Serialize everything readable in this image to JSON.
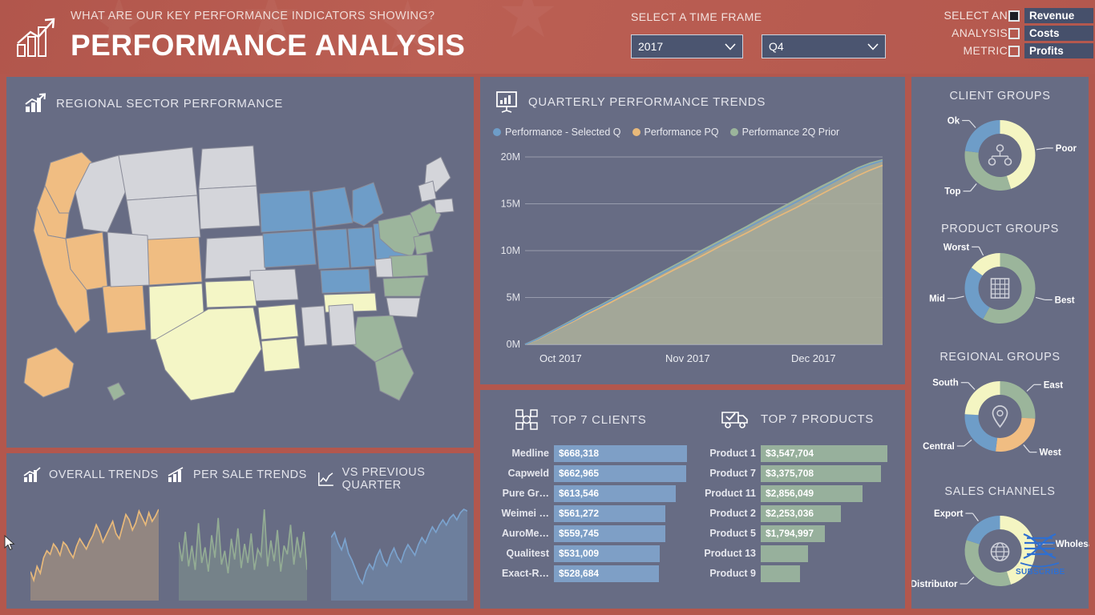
{
  "header": {
    "subtitle": "WHAT ARE OUR KEY PERFORMANCE INDICATORS SHOWING?",
    "title": "PERFORMANCE ANALYSIS",
    "logo_icon": "bar-chart-arrow-icon",
    "timeframe_label": "SELECT A TIME FRAME",
    "year_value": "2017",
    "quarter_value": "Q4",
    "metric_label_1": "SELECT AN",
    "metric_label_2": "ANALYSIS",
    "metric_label_3": "METRIC",
    "metrics": [
      {
        "label": "Revenue",
        "checked": true
      },
      {
        "label": "Costs",
        "checked": false
      },
      {
        "label": "Profits",
        "checked": false
      }
    ],
    "accent_color": "#b3574d",
    "panel_color": "#676c84"
  },
  "map_panel": {
    "title": "REGIONAL SECTOR PERFORMANCE",
    "icon": "chart-growth-icon",
    "legend_colors": {
      "high_orange": "#f0bd82",
      "mid_blue": "#6e9dc8",
      "low_yellow": "#f4f6c6",
      "green": "#9cb59c",
      "gray": "#d4d5da"
    }
  },
  "trends_panel": {
    "items": [
      {
        "label": "OVERALL TRENDS",
        "icon": "chart-growth-icon",
        "color": "#e8b97a"
      },
      {
        "label": "PER SALE TRENDS",
        "icon": "bar-chart-icon",
        "color": "#93ac94"
      },
      {
        "label": "VS PREVIOUS QUARTER",
        "icon": "line-chart-icon",
        "color": "#7ba3ce"
      }
    ]
  },
  "quarterly_panel": {
    "title": "QUARTERLY PERFORMANCE TRENDS",
    "icon": "presentation-chart-icon"
  },
  "tables_panel": {
    "clients": {
      "title": "TOP 7 CLIENTS",
      "icon": "network-people-icon",
      "rows": [
        {
          "label": "Medline",
          "value": "$668,318",
          "amount": 668318
        },
        {
          "label": "Capweld",
          "value": "$662,965",
          "amount": 662965
        },
        {
          "label": "Pure Gr…",
          "value": "$613,546",
          "amount": 613546
        },
        {
          "label": "Weimei …",
          "value": "$561,272",
          "amount": 561272
        },
        {
          "label": "AuroMe…",
          "value": "$559,745",
          "amount": 559745
        },
        {
          "label": "Qualitest",
          "value": "$531,009",
          "amount": 531009
        },
        {
          "label": "Exact-R…",
          "value": "$528,684",
          "amount": 528684
        }
      ]
    },
    "products": {
      "title": "TOP 7 PRODUCTS",
      "icon": "delivery-truck-check-icon",
      "rows": [
        {
          "label": "Product 1",
          "value": "$3,547,704",
          "amount": 3547704
        },
        {
          "label": "Product 7",
          "value": "$3,375,708",
          "amount": 3375708
        },
        {
          "label": "Product 11",
          "value": "$2,856,049",
          "amount": 2856049
        },
        {
          "label": "Product 2",
          "value": "$2,253,036",
          "amount": 2253036
        },
        {
          "label": "Product 5",
          "value": "$1,794,997",
          "amount": 1794997
        },
        {
          "label": "Product 13",
          "value": "",
          "amount": 1330000
        },
        {
          "label": "Product 9",
          "value": "",
          "amount": 1100000
        }
      ]
    }
  },
  "right_panel": {
    "donuts": [
      {
        "title": "CLIENT GROUPS",
        "icon": "org-people-icon",
        "segments": [
          {
            "label": "Poor",
            "value": 45,
            "color": "#f4f5c2"
          },
          {
            "label": "Top",
            "value": 32,
            "color": "#9bb59b"
          },
          {
            "label": "Ok",
            "value": 23,
            "color": "#6e9dc8"
          }
        ]
      },
      {
        "title": "PRODUCT GROUPS",
        "icon": "abacus-icon",
        "segments": [
          {
            "label": "Best",
            "value": 58,
            "color": "#9bb59b"
          },
          {
            "label": "Mid",
            "value": 27,
            "color": "#6e9dc8"
          },
          {
            "label": "Worst",
            "value": 15,
            "color": "#f4f5c2"
          }
        ]
      },
      {
        "title": "REGIONAL GROUPS",
        "icon": "location-pin-icon",
        "segments": [
          {
            "label": "East",
            "value": 26,
            "color": "#9bb59b"
          },
          {
            "label": "West",
            "value": 26,
            "color": "#f0bd82"
          },
          {
            "label": "Central",
            "value": 24,
            "color": "#6e9dc8"
          },
          {
            "label": "South",
            "value": 24,
            "color": "#f4f5c2"
          }
        ]
      },
      {
        "title": "SALES CHANNELS",
        "icon": "globe-icon",
        "segments": [
          {
            "label": "Wholesale",
            "value": 45,
            "color": "#f4f5c2"
          },
          {
            "label": "Distributor",
            "value": 35,
            "color": "#9bb59b"
          },
          {
            "label": "Export",
            "value": 20,
            "color": "#6e9dc8"
          }
        ]
      }
    ]
  },
  "watermark": {
    "text": "SUBSCRIBE",
    "icon": "dna-icon"
  },
  "chart_data": {
    "type": "area",
    "title": "QUARTERLY PERFORMANCE TRENDS",
    "xlabel": "",
    "ylabel": "",
    "ylim": [
      0,
      20000000
    ],
    "ytick_labels": [
      "0M",
      "5M",
      "10M",
      "15M",
      "20M"
    ],
    "ytick_values": [
      0,
      5000000,
      10000000,
      15000000,
      20000000
    ],
    "xtick_labels": [
      "Oct 2017",
      "Nov 2017",
      "Dec 2017"
    ],
    "grid": true,
    "legend_position": "top-left",
    "series": [
      {
        "name": "Performance - Selected Q",
        "color": "#6e9dc8",
        "values": [
          0,
          0.55,
          1.25,
          1.95,
          2.6,
          3.35,
          4.0,
          4.7,
          5.4,
          6.1,
          6.8,
          7.5,
          8.2,
          8.9,
          9.6,
          10.3,
          11.0,
          11.7,
          12.4,
          13.1,
          13.8,
          14.5,
          15.2,
          15.9,
          16.6,
          17.3,
          18.0,
          18.7,
          19.2,
          19.6
        ]
      },
      {
        "name": "Performance PQ",
        "color": "#e8b97a",
        "values": [
          0,
          0.5,
          1.2,
          1.85,
          2.5,
          3.2,
          3.85,
          4.5,
          5.2,
          5.85,
          6.5,
          7.2,
          7.9,
          8.55,
          9.2,
          9.9,
          10.6,
          11.25,
          11.9,
          12.6,
          13.3,
          13.95,
          14.6,
          15.3,
          16.0,
          16.7,
          17.35,
          18.0,
          18.6,
          19.1
        ]
      },
      {
        "name": "Performance 2Q Prior",
        "color": "#9bb59b",
        "values": [
          0,
          0.6,
          1.3,
          2.0,
          2.7,
          3.45,
          4.1,
          4.8,
          5.5,
          6.2,
          6.95,
          7.65,
          8.35,
          9.05,
          9.8,
          10.5,
          11.2,
          11.9,
          12.6,
          13.35,
          14.05,
          14.75,
          15.45,
          16.15,
          16.85,
          17.5,
          18.2,
          18.85,
          19.35,
          19.7
        ]
      }
    ],
    "units": "millions"
  },
  "sparkline_data": [
    {
      "name": "OVERALL TRENDS",
      "type": "area",
      "color": "#e8b97a",
      "values": [
        28,
        18,
        34,
        26,
        44,
        52,
        48,
        60,
        55,
        47,
        62,
        58,
        50,
        44,
        57,
        66,
        60,
        54,
        63,
        70,
        82,
        74,
        62,
        70,
        78,
        86,
        72,
        66,
        80,
        94,
        88,
        76,
        84,
        98,
        90,
        82,
        96,
        86,
        92,
        100
      ]
    },
    {
      "name": "PER SALE TRENDS",
      "type": "area",
      "color": "#93ac94",
      "values": [
        62,
        40,
        74,
        34,
        58,
        30,
        84,
        38,
        56,
        28,
        70,
        44,
        90,
        36,
        52,
        26,
        66,
        42,
        78,
        32,
        60,
        38,
        72,
        30,
        54,
        46,
        100,
        34,
        64,
        40,
        76,
        28,
        58,
        48,
        82,
        36,
        68,
        44,
        74,
        30
      ]
    },
    {
      "name": "VS PREVIOUS QUARTER",
      "type": "area",
      "color": "#7ba3ce",
      "values": [
        66,
        72,
        60,
        52,
        64,
        48,
        40,
        30,
        20,
        14,
        28,
        36,
        30,
        44,
        52,
        40,
        34,
        46,
        54,
        44,
        38,
        50,
        58,
        52,
        46,
        58,
        66,
        60,
        70,
        78,
        72,
        80,
        86,
        80,
        88,
        92,
        86,
        94,
        98,
        96
      ]
    }
  ],
  "map_data": {
    "type": "choropleth",
    "region": "United States",
    "categories": [
      "high",
      "upper-mid",
      "mid",
      "low",
      "none"
    ]
  }
}
